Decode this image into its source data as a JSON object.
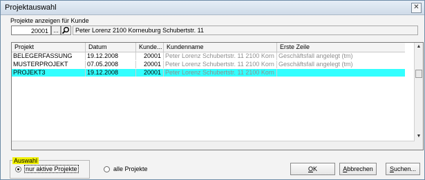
{
  "window": {
    "title": "Projektauswahl",
    "close_glyph": "✕"
  },
  "filter": {
    "label": "Projekte anzeigen für Kunde",
    "customer_number": "20001",
    "browse_button": "...",
    "customer_info": "Peter Lorenz 2100  Korneuburg Schubertstr. 11"
  },
  "table": {
    "columns": [
      "Projekt",
      "Datum",
      "Kunde...",
      "Kundenname",
      "Erste Zeile"
    ],
    "rows": [
      {
        "projekt": "BELEGERFASSUNG",
        "datum": "19.12.2008",
        "kunde": "20001",
        "kundenname": "Peter Lorenz  Schubertstr. 11  2100  Korn",
        "erste_zeile": "Geschäftsfall angelegt (tm)",
        "selected": false
      },
      {
        "projekt": "MUSTERPROJEKT",
        "datum": "07.05.2008",
        "kunde": "20001",
        "kundenname": "Peter Lorenz  Schubertstr. 11  2100  Korn",
        "erste_zeile": "Geschäftsfall angelegt (tm)",
        "selected": false
      },
      {
        "projekt": "PROJEKT3",
        "datum": "19.12.2008",
        "kunde": "20001",
        "kundenname": "Peter Lorenz  Schubertstr. 11  2100  Korn",
        "erste_zeile": "",
        "selected": true
      }
    ],
    "selected_color": "#33ffff"
  },
  "auswahl": {
    "label": "Auswahl",
    "option_active": "nur aktive Projekte",
    "option_all": "alle Projekte",
    "selected": "active"
  },
  "buttons": {
    "ok_u": "O",
    "ok_rest": "K",
    "abbrechen_u": "A",
    "abbrechen_rest": "bbrechen",
    "suchen_u": "S",
    "suchen_rest": "uchen..."
  }
}
